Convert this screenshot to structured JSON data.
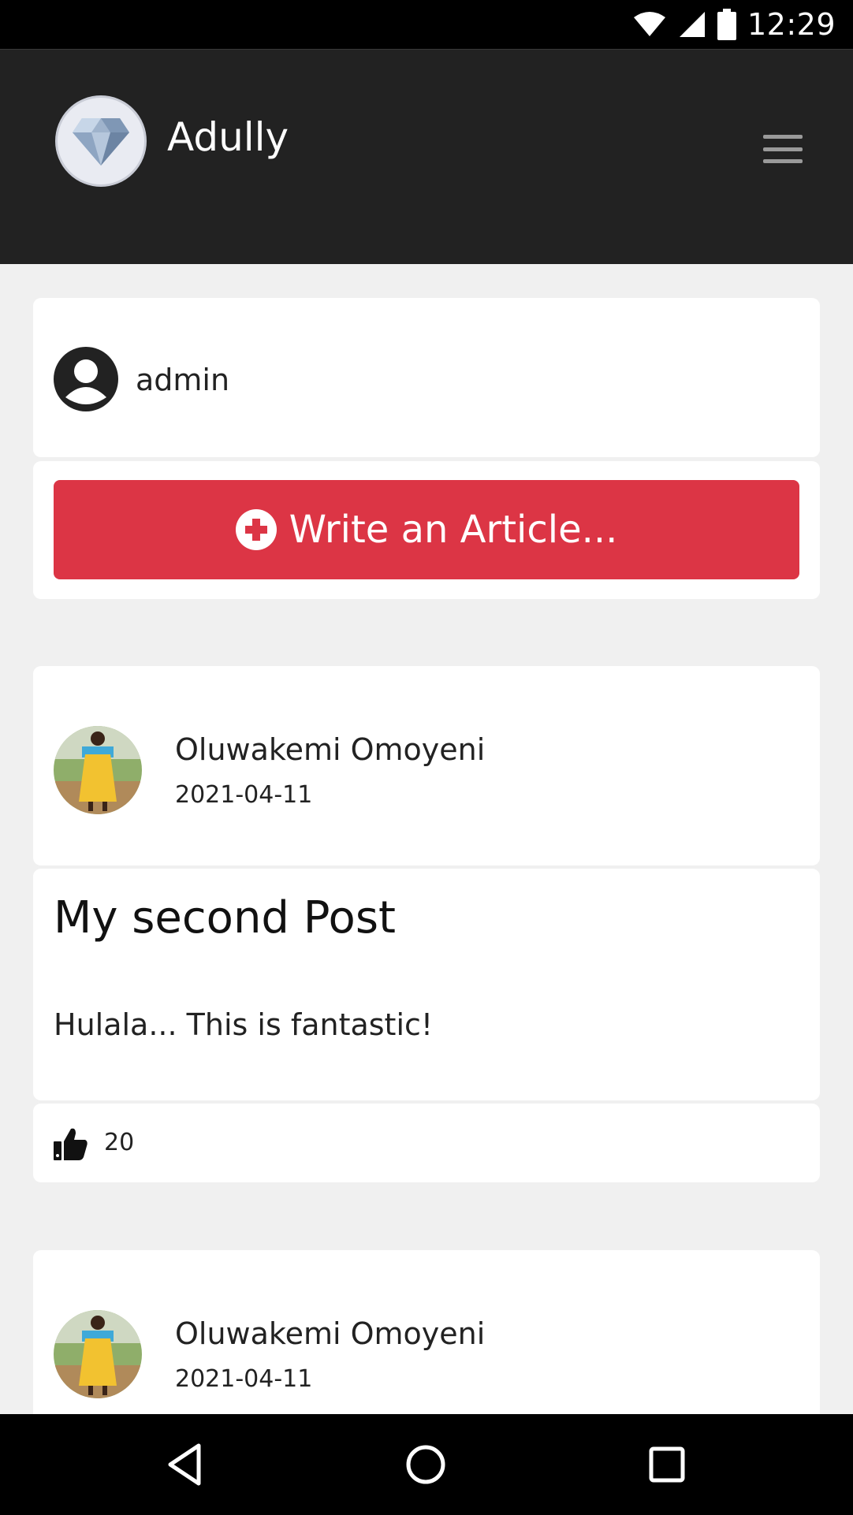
{
  "status_bar": {
    "time": "12:29"
  },
  "header": {
    "app_title": "Adully"
  },
  "user": {
    "name": "admin"
  },
  "actions": {
    "write_label": "Write an Article..."
  },
  "posts": [
    {
      "author": "Oluwakemi Omoyeni",
      "date": "2021-04-11",
      "title": "My second Post",
      "excerpt": "Hulala... This is fantastic!",
      "likes": "20"
    },
    {
      "author": "Oluwakemi Omoyeni",
      "date": "2021-04-11"
    }
  ],
  "colors": {
    "header_bg": "#222222",
    "accent_red": "#dc3545",
    "page_bg": "#f0f0f0"
  },
  "icons": [
    "wifi-icon",
    "signal-icon",
    "battery-icon",
    "diamond-logo",
    "hamburger-icon",
    "user-circle-icon",
    "plus-circle-icon",
    "thumbs-up-icon",
    "back-icon",
    "home-icon",
    "recents-icon"
  ]
}
